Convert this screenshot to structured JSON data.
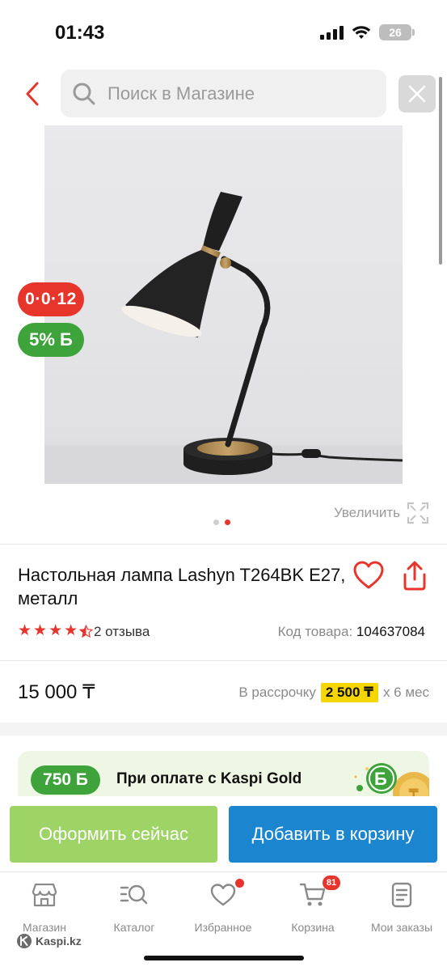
{
  "status_bar": {
    "time": "01:43",
    "battery": "26"
  },
  "header": {
    "search_placeholder": "Поиск в Магазине"
  },
  "product": {
    "badge_installment": "0·0·12",
    "badge_bonus": "5% Б",
    "zoom_label": "Увеличить",
    "pager": {
      "count": 2,
      "active": 2
    },
    "title": "Настольная лампа Lashyn T264BK E27, металл",
    "rating": 4.5,
    "reviews": "2 отзыва",
    "code_label": "Код товара:",
    "code_value": "104637084",
    "price": "15 000 ₸",
    "installment_prefix": "В рассрочку",
    "installment_amount": "2 500 ₸",
    "installment_suffix": "x 6 мес"
  },
  "gold_banner": {
    "badge": "750 Б",
    "text": "При оплате с Kaspi Gold"
  },
  "actions": {
    "buy_now": "Оформить сейчас",
    "add_to_cart": "Добавить в корзину"
  },
  "bottom_nav": {
    "items": [
      {
        "label": "Магазин",
        "icon": "store-icon"
      },
      {
        "label": "Каталог",
        "icon": "catalog-search-icon"
      },
      {
        "label": "Избранное",
        "icon": "heart-icon",
        "dot": true
      },
      {
        "label": "Корзина",
        "icon": "cart-icon",
        "count": "81"
      },
      {
        "label": "Мои заказы",
        "icon": "orders-icon"
      }
    ]
  },
  "footer": {
    "brand": "Kaspi.kz"
  },
  "colors": {
    "accent_red": "#e8352c",
    "bonus_green": "#3ea33b",
    "buy_green": "#9ed366",
    "cart_blue": "#1b86cf",
    "highlight_yellow": "#f6d500"
  }
}
